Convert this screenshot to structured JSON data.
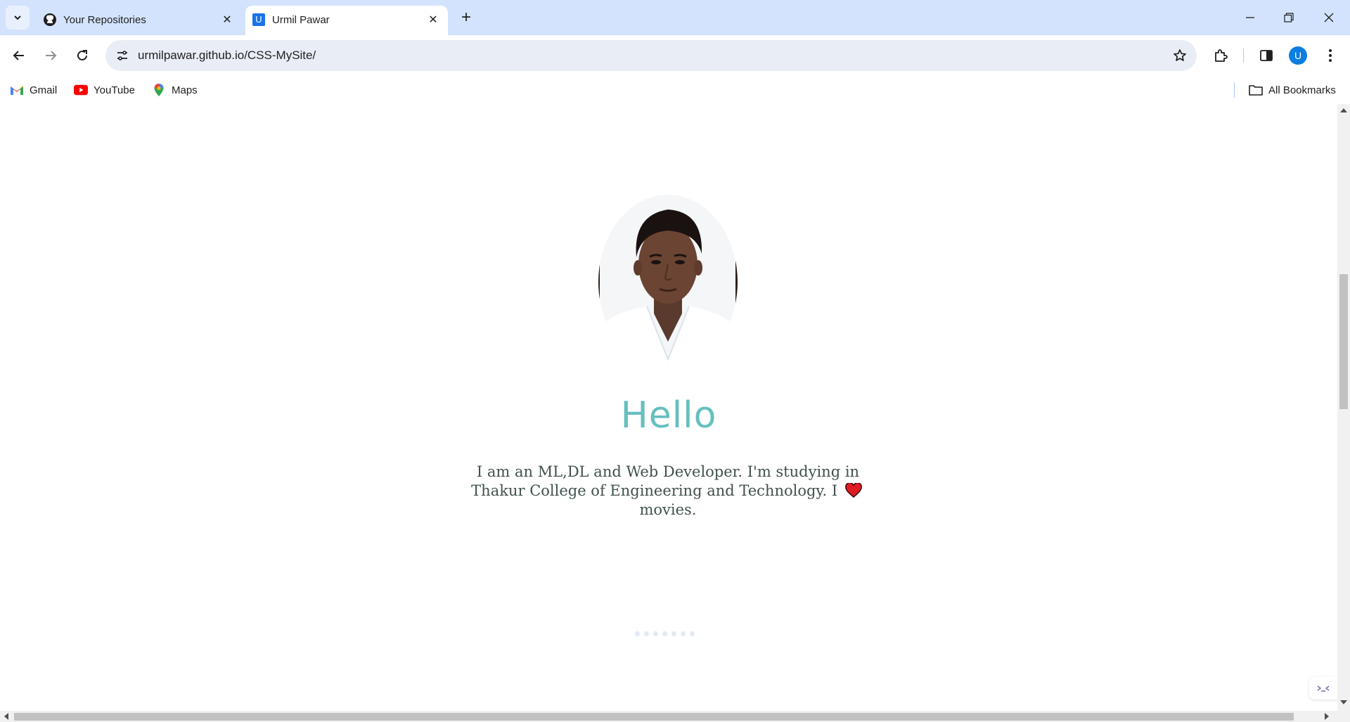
{
  "browser": {
    "tabs": [
      {
        "title": "Your Repositories",
        "icon": "github-icon",
        "active": false
      },
      {
        "title": "Urmil Pawar",
        "icon": "site-favicon-u",
        "favicon_letter": "U",
        "active": true
      }
    ],
    "address_bar": {
      "url": "urmilpawar.github.io/CSS-MySite/"
    },
    "profile_initial": "U",
    "bookmarks": [
      {
        "label": "Gmail",
        "icon": "gmail-icon"
      },
      {
        "label": "YouTube",
        "icon": "youtube-icon"
      },
      {
        "label": "Maps",
        "icon": "maps-icon"
      }
    ],
    "all_bookmarks_label": "All Bookmarks",
    "colors": {
      "tabstrip": "#d3e3fd",
      "omnibox": "#e9eef6",
      "accent": "#0b7ee0"
    }
  },
  "page": {
    "heading": "Hello",
    "intro_before": "I am an ML,DL and Web Developer. I'm studying in Thakur College of Engineering and Technology. I",
    "intro_after": "movies.",
    "heart_icon": "red-heart-icon",
    "colors": {
      "heading": "#66BFBF",
      "text": "#40514E"
    }
  }
}
